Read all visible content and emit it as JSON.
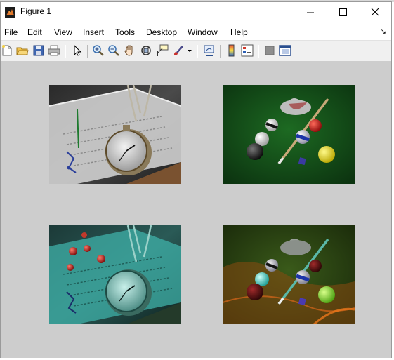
{
  "window": {
    "title": "Figure 1",
    "controls": [
      "minimize-icon",
      "maximize-icon",
      "close-icon"
    ]
  },
  "menu": {
    "items": [
      "File",
      "Edit",
      "View",
      "Insert",
      "Tools",
      "Desktop",
      "Window",
      "Help"
    ]
  },
  "toolbar": {
    "buttons": [
      "new-figure-icon",
      "open-file-icon",
      "save-icon",
      "print-icon",
      "edit-plot-arrow-icon",
      "zoom-in-icon",
      "zoom-out-icon",
      "pan-hand-icon",
      "rotate-3d-icon",
      "data-cursor-icon",
      "brush-icon",
      "brush-dropdown-icon",
      "link-plot-icon",
      "colorbar-icon",
      "legend-icon",
      "hide-plot-tools-icon",
      "show-plot-tools-icon"
    ]
  },
  "figure": {
    "background": "#cdcdcd",
    "images": [
      {
        "id": "pocket-watch-image",
        "colormap": "original"
      },
      {
        "id": "billiard-balls-image",
        "colormap": "original"
      },
      {
        "id": "pocket-watch-image",
        "colormap": "fused-with-billiard-balls"
      },
      {
        "id": "billiard-balls-image",
        "colormap": "fused-with-pocket-watch"
      }
    ]
  }
}
